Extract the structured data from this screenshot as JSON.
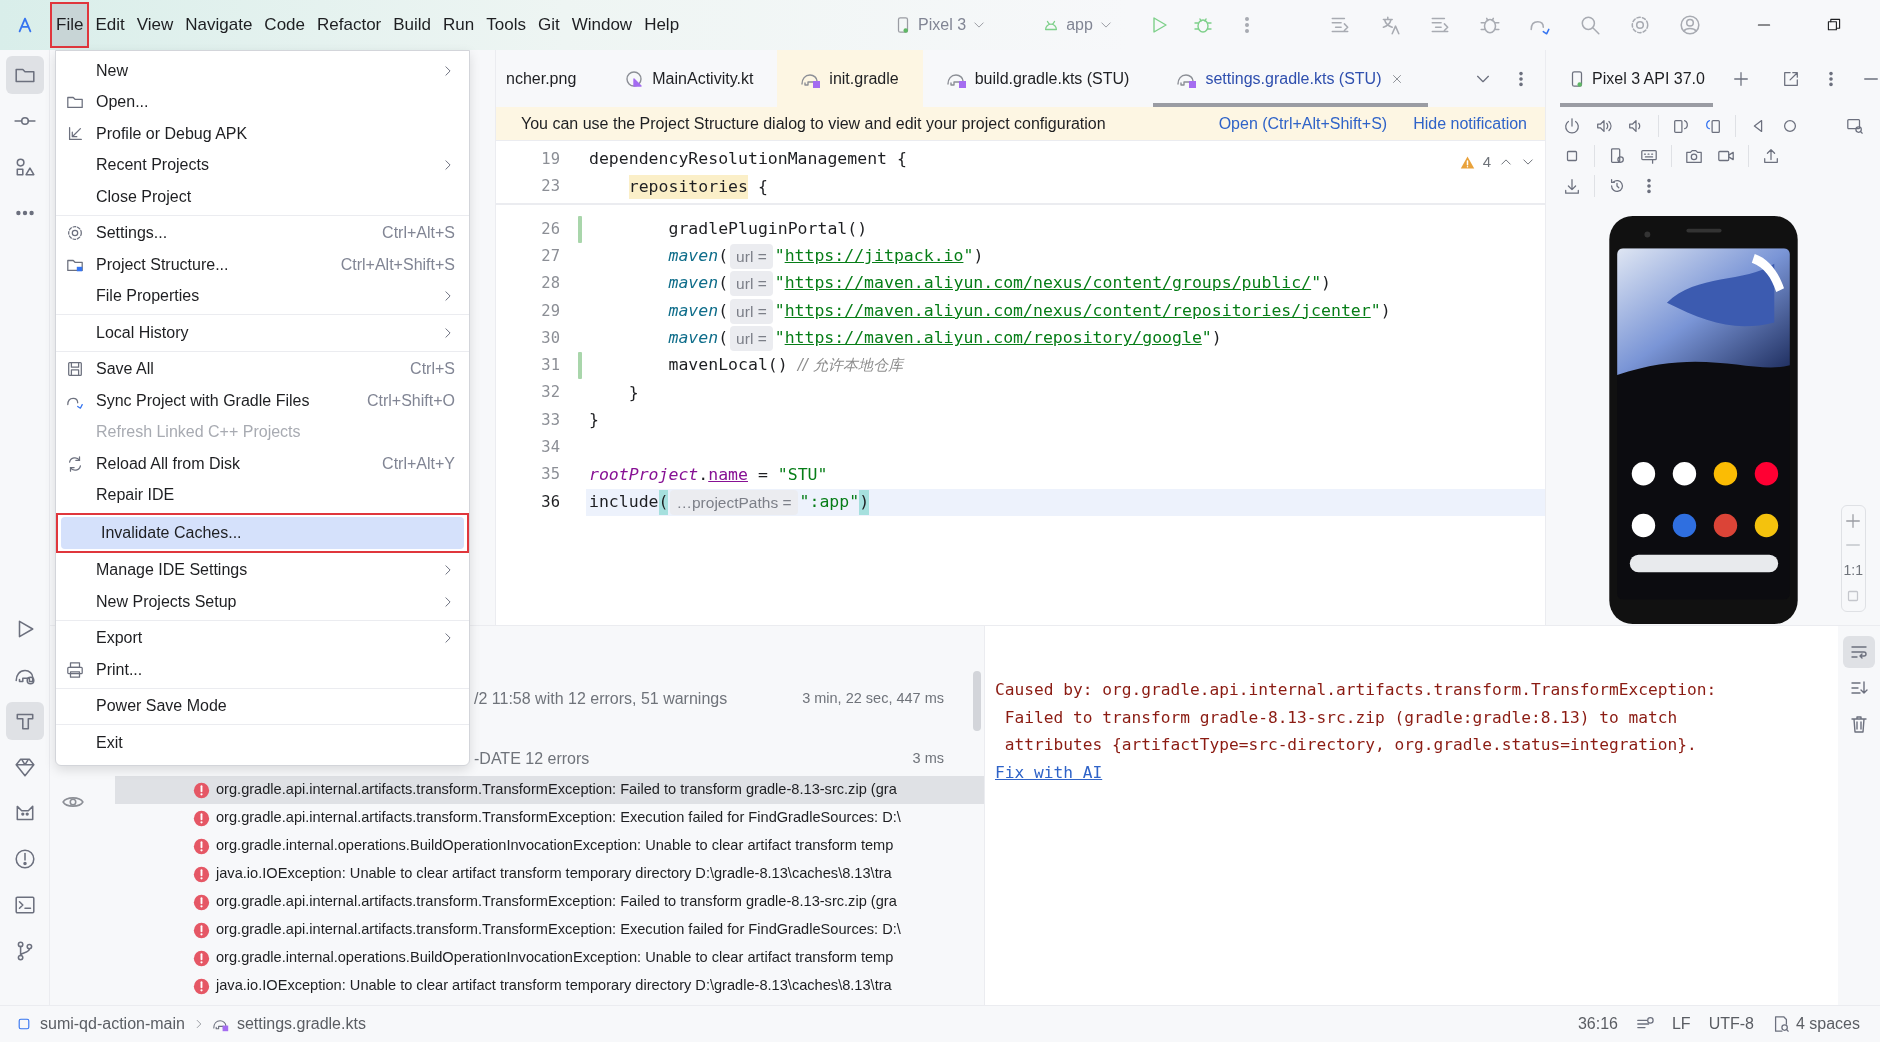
{
  "title_bar": {
    "menus": [
      {
        "label": "File",
        "selected": true,
        "annotated": true
      },
      {
        "label": "Edit",
        "selected": false,
        "annotated": false
      },
      {
        "label": "View",
        "selected": false,
        "annotated": false
      },
      {
        "label": "Navigate",
        "selected": false,
        "annotated": false
      },
      {
        "label": "Code",
        "selected": false,
        "annotated": false
      },
      {
        "label": "Refactor",
        "selected": false,
        "annotated": false
      },
      {
        "label": "Build",
        "selected": false,
        "annotated": false
      },
      {
        "label": "Run",
        "selected": false,
        "annotated": false
      },
      {
        "label": "Tools",
        "selected": false,
        "annotated": false
      },
      {
        "label": "Git",
        "selected": false,
        "annotated": false
      },
      {
        "label": "Window",
        "selected": false,
        "annotated": false
      },
      {
        "label": "Help",
        "selected": false,
        "annotated": false
      }
    ],
    "device": "Pixel 3",
    "run_config": "app"
  },
  "tool_strip": {
    "top": [
      {
        "kind": "folder",
        "selected": true
      },
      {
        "kind": "commit",
        "selected": false
      },
      {
        "kind": "shapes",
        "selected": false
      },
      {
        "kind": "more",
        "selected": false
      }
    ],
    "bottom": [
      {
        "kind": "run",
        "selected": false
      },
      {
        "kind": "elephant",
        "selected": false
      },
      {
        "kind": "hammer",
        "selected": true
      },
      {
        "kind": "gem",
        "selected": false
      },
      {
        "kind": "cat",
        "selected": false
      },
      {
        "kind": "problems",
        "selected": false
      },
      {
        "kind": "terminal",
        "selected": false
      },
      {
        "kind": "branch",
        "selected": false
      }
    ]
  },
  "file_menu": {
    "items": [
      {
        "kind": "plain",
        "label": "New",
        "submenu": true,
        "disabled": false,
        "selected": false,
        "annotated": false
      },
      {
        "kind": "folder",
        "label": "Open...",
        "submenu": false,
        "disabled": false,
        "selected": false,
        "annotated": false
      },
      {
        "kind": "apk",
        "label": "Profile or Debug APK",
        "submenu": false,
        "disabled": false,
        "selected": false,
        "annotated": false
      },
      {
        "kind": "plain",
        "label": "Recent Projects",
        "submenu": true,
        "disabled": false,
        "selected": false,
        "annotated": false
      },
      {
        "kind": "plain",
        "label": "Close Project",
        "submenu": false,
        "disabled": false,
        "selected": false,
        "annotated": false
      },
      {
        "kind": "separator"
      },
      {
        "kind": "gear",
        "label": "Settings...",
        "shortcut": "Ctrl+Alt+S",
        "submenu": false,
        "disabled": false,
        "selected": false,
        "annotated": false
      },
      {
        "kind": "structure",
        "label": "Project Structure...",
        "shortcut": "Ctrl+Alt+Shift+S",
        "submenu": false,
        "disabled": false,
        "selected": false,
        "annotated": false
      },
      {
        "kind": "plain",
        "label": "File Properties",
        "submenu": true,
        "disabled": false,
        "selected": false,
        "annotated": false
      },
      {
        "kind": "separator"
      },
      {
        "kind": "plain",
        "label": "Local History",
        "submenu": true,
        "disabled": false,
        "selected": false,
        "annotated": false
      },
      {
        "kind": "separator"
      },
      {
        "kind": "save",
        "label": "Save All",
        "shortcut": "Ctrl+S",
        "submenu": false,
        "disabled": false,
        "selected": false,
        "annotated": false
      },
      {
        "kind": "sync",
        "label": "Sync Project with Gradle Files",
        "shortcut": "Ctrl+Shift+O",
        "submenu": false,
        "disabled": false,
        "selected": false,
        "annotated": false
      },
      {
        "kind": "plain",
        "label": "Refresh Linked C++ Projects",
        "submenu": false,
        "disabled": true,
        "selected": false,
        "annotated": false
      },
      {
        "kind": "reload",
        "label": "Reload All from Disk",
        "shortcut": "Ctrl+Alt+Y",
        "submenu": false,
        "disabled": false,
        "selected": false,
        "annotated": false
      },
      {
        "kind": "plain",
        "label": "Repair IDE",
        "submenu": false,
        "disabled": false,
        "selected": false,
        "annotated": false
      },
      {
        "kind": "plain",
        "label": "Invalidate Caches...",
        "submenu": false,
        "disabled": false,
        "selected": true,
        "annotated": true
      },
      {
        "kind": "plain",
        "label": "Manage IDE Settings",
        "submenu": true,
        "disabled": false,
        "selected": false,
        "annotated": false
      },
      {
        "kind": "plain",
        "label": "New Projects Setup",
        "submenu": true,
        "disabled": false,
        "selected": false,
        "annotated": false
      },
      {
        "kind": "separator"
      },
      {
        "kind": "plain",
        "label": "Export",
        "submenu": true,
        "disabled": false,
        "selected": false,
        "annotated": false
      },
      {
        "kind": "print",
        "label": "Print...",
        "submenu": false,
        "disabled": false,
        "selected": false,
        "annotated": false
      },
      {
        "kind": "separator"
      },
      {
        "kind": "plain",
        "label": "Power Save Mode",
        "submenu": false,
        "disabled": false,
        "selected": false,
        "annotated": false
      },
      {
        "kind": "separator"
      },
      {
        "kind": "plain",
        "label": "Exit",
        "submenu": false,
        "disabled": false,
        "selected": false,
        "annotated": false
      }
    ]
  },
  "editor": {
    "tabs": [
      {
        "label": "ncher.png",
        "selected": false,
        "tinted": false
      },
      {
        "label": "MainActivity.kt",
        "kind": "kotlin",
        "selected": false,
        "tinted": false
      },
      {
        "label": "init.gradle",
        "kind": "gradle",
        "selected": false,
        "tinted": true
      },
      {
        "label": "build.gradle.kts (STU)",
        "kind": "gradle",
        "selected": false,
        "tinted": false
      },
      {
        "label": "settings.gradle.kts (STU)",
        "kind": "gradle",
        "selected": true,
        "tinted": false
      }
    ],
    "notification": {
      "text": "You can use the Project Structure dialog to view and edit your project configuration",
      "actions": [
        "Open (Ctrl+Alt+Shift+S)",
        "Hide notification"
      ]
    },
    "warning_count": "4",
    "sticky_lines": [
      {
        "number": "19",
        "tokens": [
          {
            "kind": "plain",
            "text": "dependencyResolutionManagement {"
          }
        ]
      },
      {
        "number": "23",
        "tokens": [
          {
            "kind": "mark",
            "text": "    repositories"
          },
          {
            "kind": "plain",
            "text": " {"
          }
        ]
      }
    ],
    "lines": [
      {
        "number": "26",
        "changed": true,
        "current": false,
        "tokens": [
          {
            "kind": "plain",
            "text": "        gradlePluginPortal()"
          }
        ]
      },
      {
        "number": "27",
        "changed": false,
        "current": false,
        "tokens": [
          {
            "kind": "fn",
            "text": "        maven"
          },
          {
            "kind": "plain",
            "text": "("
          },
          {
            "kind": "hint",
            "text": "url ="
          },
          {
            "kind": "string",
            "text": "\""
          },
          {
            "kind": "url",
            "text": "https://jitpack.io"
          },
          {
            "kind": "string",
            "text": "\""
          },
          {
            "kind": "plain",
            "text": ")"
          }
        ]
      },
      {
        "number": "28",
        "changed": false,
        "current": false,
        "tokens": [
          {
            "kind": "fn",
            "text": "        maven"
          },
          {
            "kind": "plain",
            "text": "("
          },
          {
            "kind": "hint",
            "text": "url ="
          },
          {
            "kind": "string",
            "text": "\""
          },
          {
            "kind": "url",
            "text": "https://maven.aliyun.com/nexus/content/groups/public/"
          },
          {
            "kind": "string",
            "text": "\""
          },
          {
            "kind": "plain",
            "text": ")"
          }
        ]
      },
      {
        "number": "29",
        "changed": false,
        "current": false,
        "tokens": [
          {
            "kind": "fn",
            "text": "        maven"
          },
          {
            "kind": "plain",
            "text": "("
          },
          {
            "kind": "hint",
            "text": "url ="
          },
          {
            "kind": "string",
            "text": "\""
          },
          {
            "kind": "url",
            "text": "https://maven.aliyun.com/nexus/content/repositories/jcenter"
          },
          {
            "kind": "string",
            "text": "\""
          },
          {
            "kind": "plain",
            "text": ")"
          }
        ]
      },
      {
        "number": "30",
        "changed": false,
        "current": false,
        "tokens": [
          {
            "kind": "fn",
            "text": "        maven"
          },
          {
            "kind": "plain",
            "text": "("
          },
          {
            "kind": "hint",
            "text": "url ="
          },
          {
            "kind": "string",
            "text": "\""
          },
          {
            "kind": "url",
            "text": "https://maven.aliyun.com/repository/google"
          },
          {
            "kind": "string",
            "text": "\""
          },
          {
            "kind": "plain",
            "text": ")"
          }
        ]
      },
      {
        "number": "31",
        "changed": true,
        "current": false,
        "tokens": [
          {
            "kind": "plain",
            "text": "        mavenLocal() "
          },
          {
            "kind": "comment",
            "text": "// 允许本地仓库"
          }
        ]
      },
      {
        "number": "32",
        "changed": false,
        "current": false,
        "tokens": [
          {
            "kind": "plain",
            "text": "    }"
          }
        ]
      },
      {
        "number": "33",
        "changed": false,
        "current": false,
        "tokens": [
          {
            "kind": "plain",
            "text": "}"
          }
        ]
      },
      {
        "number": "34",
        "changed": false,
        "current": false
      },
      {
        "number": "35",
        "changed": false,
        "current": false,
        "tokens": [
          {
            "kind": "prop",
            "text": "rootProject"
          },
          {
            "kind": "plain",
            "text": "."
          },
          {
            "kind": "propu",
            "text": "name"
          },
          {
            "kind": "plain",
            "text": " = "
          },
          {
            "kind": "string",
            "text": "\"STU\""
          }
        ]
      },
      {
        "number": "36",
        "changed": false,
        "current": true,
        "tokens": [
          {
            "kind": "plain",
            "text": "include"
          },
          {
            "kind": "brace",
            "text": "("
          },
          {
            "kind": "hint",
            "text": "…projectPaths ="
          },
          {
            "kind": "string",
            "text": "\":app\""
          },
          {
            "kind": "brace",
            "text": ")"
          }
        ]
      }
    ]
  },
  "emulator": {
    "title": "Pixel 3 API 37.0",
    "zoom_label": "1:1"
  },
  "build": {
    "summary": [
      {
        "text": "/2 11:58 with 12 errors, 51 warnings",
        "time": "3 min, 22 sec, 447 ms"
      },
      {
        "text": "-DATE 12 errors",
        "time": "3 ms"
      }
    ],
    "errors": [
      {
        "text": "org.gradle.api.internal.artifacts.transform.TransformException: Failed to transform gradle-8.13-src.zip (gra",
        "selected": true
      },
      {
        "text": "org.gradle.api.internal.artifacts.transform.TransformException: Execution failed for FindGradleSources: D:\\",
        "selected": false
      },
      {
        "text": "org.gradle.internal.operations.BuildOperationInvocationException: Unable to clear artifact transform temp",
        "selected": false
      },
      {
        "text": "java.io.IOException: Unable to clear artifact transform temporary directory D:\\gradle-8.13\\caches\\8.13\\tra",
        "selected": false
      },
      {
        "text": "org.gradle.api.internal.artifacts.transform.TransformException: Failed to transform gradle-8.13-src.zip (gra",
        "selected": false
      },
      {
        "text": "org.gradle.api.internal.artifacts.transform.TransformException: Execution failed for FindGradleSources: D:\\",
        "selected": false
      },
      {
        "text": "org.gradle.internal.operations.BuildOperationInvocationException: Unable to clear artifact transform temp",
        "selected": false
      },
      {
        "text": "java.io.IOException: Unable to clear artifact transform temporary directory D:\\gradle-8.13\\caches\\8.13\\tra",
        "selected": false
      }
    ]
  },
  "console": {
    "lines": [
      "Caused by: org.gradle.api.internal.artifacts.transform.TransformException:",
      " Failed to transform gradle-8.13-src.zip (gradle:gradle:8.13) to match",
      " attributes {artifactType=src-directory, org.gradle.status=integration}."
    ],
    "link": "Fix with AI",
    "soft_wrap": true
  },
  "status_bar": {
    "breadcrumbs": [
      "sumi-qd-action-main",
      "settings.gradle.kts"
    ],
    "position": "36:16",
    "line_separator": "LF",
    "encoding": "UTF-8",
    "indent": "4 spaces"
  }
}
